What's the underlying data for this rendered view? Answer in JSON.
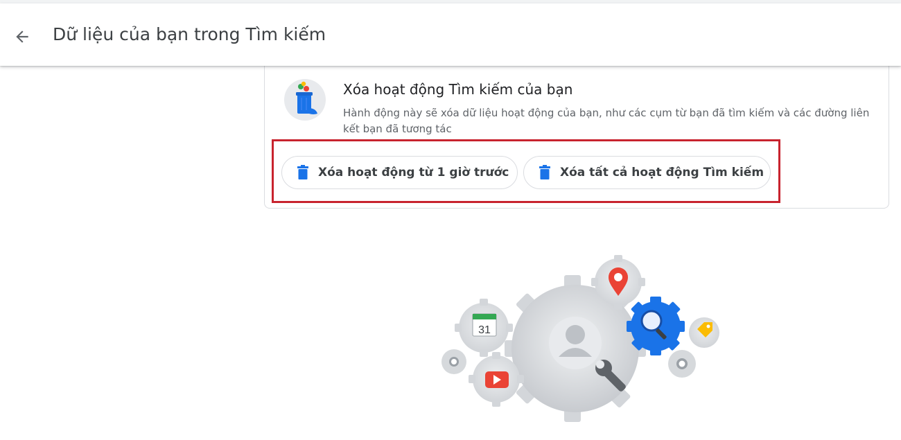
{
  "header": {
    "back_icon": "arrow-back-icon",
    "title": "Dữ liệu của bạn trong Tìm kiếm"
  },
  "delete_card": {
    "icon": "trash-bin-illustration-icon",
    "title": "Xóa hoạt động Tìm kiếm của bạn",
    "description": "Hành động này sẽ xóa dữ liệu hoạt động của bạn, như các cụm từ bạn đã tìm kiếm và các đường liên kết bạn đã tương tác",
    "buttons": [
      {
        "label": "Xóa hoạt động từ 1 giờ trước",
        "icon": "trash-icon"
      },
      {
        "label": "Xóa tất cả hoạt động Tìm kiếm",
        "icon": "trash-icon"
      }
    ]
  },
  "illustration": {
    "icon": "gears-settings-illustration",
    "calendar_day": "31"
  },
  "colors": {
    "accent_blue": "#1a73e8",
    "highlight_red": "#c8232e",
    "text_primary": "#202124",
    "text_secondary": "#5f6368"
  }
}
